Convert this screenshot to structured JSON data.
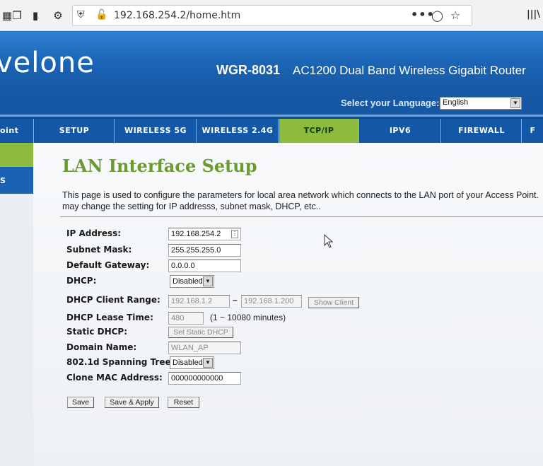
{
  "browser": {
    "url": "192.168.254.2/home.htm",
    "more_label": "•••",
    "library_label": "|||\\"
  },
  "header": {
    "brand": "velone",
    "model": "WGR-8031",
    "description": "AC1200 Dual Band Wireless Gigabit Router",
    "language_label": "Select your Language:",
    "language_value": "English"
  },
  "tabs": [
    {
      "label": "oint"
    },
    {
      "label": "SETUP"
    },
    {
      "label": "WIRELESS 5G"
    },
    {
      "label": "WIRELESS 2.4G"
    },
    {
      "label": "TCP/IP"
    },
    {
      "label": "IPV6"
    },
    {
      "label": "FIREWALL"
    },
    {
      "label": "F"
    }
  ],
  "sidenav": {
    "item_label": "S"
  },
  "main": {
    "title": "LAN Interface Setup",
    "intro_line1": "This page is used to configure the parameters for local area network which connects to the LAN port of your Access Point.",
    "intro_line2": "may change the setting for IP addresss, subnet mask, DHCP, etc..",
    "fields": {
      "ip_label": "IP Address:",
      "ip_value": "192.168.254.2",
      "subnet_label": "Subnet Mask:",
      "subnet_value": "255.255.255.0",
      "gateway_label": "Default Gateway:",
      "gateway_value": "0.0.0.0",
      "dhcp_label": "DHCP:",
      "dhcp_value": "Disabled",
      "range_label": "DHCP Client Range:",
      "range_start": "192.168.1.2",
      "range_sep": "–",
      "range_end": "192.168.1.200",
      "show_client_label": "Show Client",
      "lease_label": "DHCP Lease Time:",
      "lease_value": "480",
      "lease_note": "(1 ~ 10080 minutes)",
      "static_label": "Static DHCP:",
      "static_button": "Set Static DHCP",
      "domain_label": "Domain Name:",
      "domain_value": "WLAN_AP",
      "stp_label": "802.1d Spanning Tree:",
      "stp_value": "Disabled",
      "clone_label": "Clone MAC Address:",
      "clone_value": "000000000000"
    },
    "buttons": {
      "save": "Save",
      "save_apply": "Save & Apply",
      "reset": "Reset"
    }
  },
  "colors": {
    "banner_blue": "#1a63b3",
    "active_tab_green": "#8dbb3e",
    "title_green": "#6b9a2e"
  },
  "icons": [
    "tab-icon",
    "copy-icon",
    "battery-icon",
    "gear-icon",
    "shield-icon",
    "lock-icon",
    "more-icon",
    "pocket-icon",
    "star-icon",
    "library-icon",
    "cursor-icon",
    "chevron-down-icon"
  ]
}
